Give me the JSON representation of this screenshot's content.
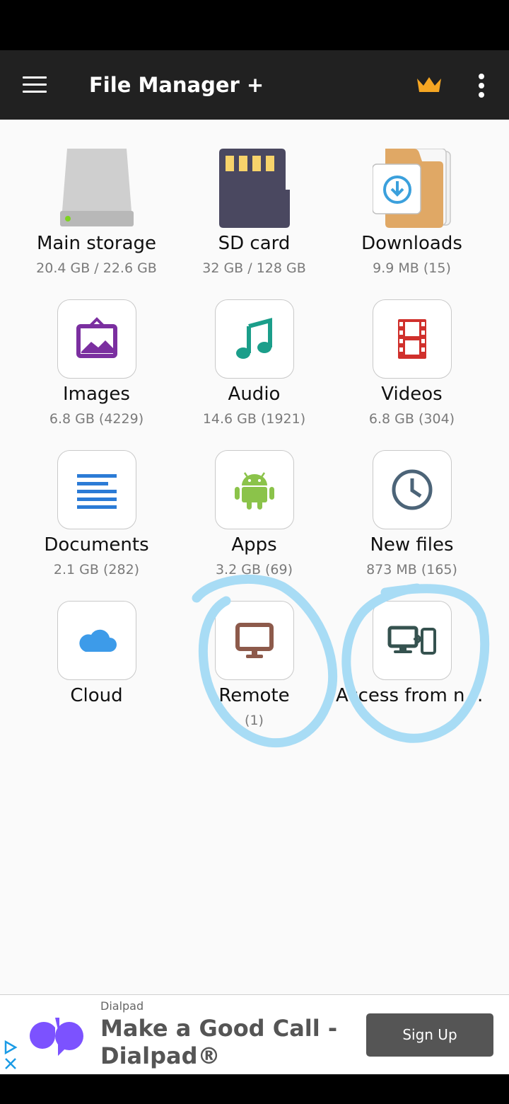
{
  "app_bar": {
    "title": "File Manager +",
    "icons": [
      "menu-icon",
      "crown-icon",
      "more-vertical-icon"
    ],
    "accent_color": "#f5a623"
  },
  "tiles": [
    {
      "name": "Main storage",
      "sub": "20.4 GB / 22.6 GB",
      "icon": "hard-drive-icon"
    },
    {
      "name": "SD card",
      "sub": "32 GB / 128 GB",
      "icon": "sd-card-icon"
    },
    {
      "name": "Downloads",
      "sub": "9.9 MB (15)",
      "icon": "downloads-folder-icon"
    },
    {
      "name": "Images",
      "sub": "6.8 GB (4229)",
      "icon": "image-frame-icon"
    },
    {
      "name": "Audio",
      "sub": "14.6 GB (1921)",
      "icon": "music-note-icon"
    },
    {
      "name": "Videos",
      "sub": "6.8 GB (304)",
      "icon": "film-strip-icon"
    },
    {
      "name": "Documents",
      "sub": "2.1 GB (282)",
      "icon": "document-lines-icon"
    },
    {
      "name": "Apps",
      "sub": "3.2 GB (69)",
      "icon": "android-icon"
    },
    {
      "name": "New files",
      "sub": "873 MB (165)",
      "icon": "clock-icon"
    },
    {
      "name": "Cloud",
      "sub": "",
      "icon": "cloud-icon"
    },
    {
      "name": "Remote",
      "sub": "(1)",
      "icon": "monitor-icon"
    },
    {
      "name": "Access from ne…",
      "sub": "",
      "icon": "devices-transfer-icon"
    }
  ],
  "annotation_color": "#a8dcf5",
  "ad": {
    "advertiser": "Dialpad",
    "headline": "Make a Good Call - Dialpad®",
    "cta": "Sign Up",
    "brand_color": "#7c52ff",
    "icons": [
      "ad-choices-icon",
      "dialpad-logo"
    ]
  }
}
